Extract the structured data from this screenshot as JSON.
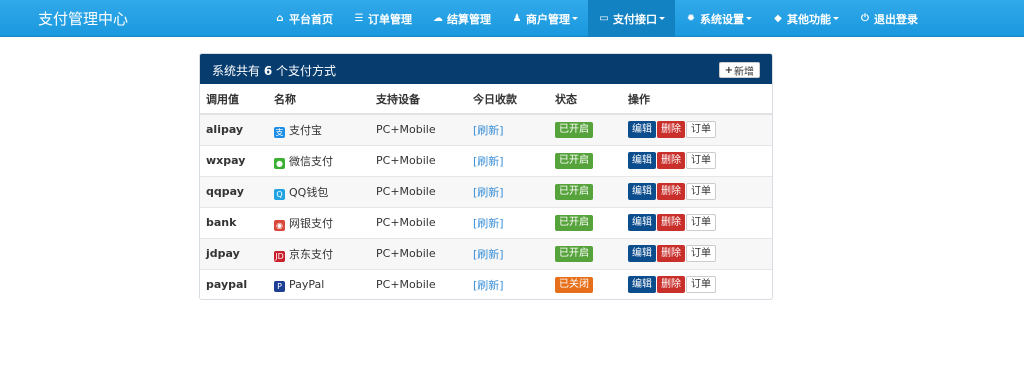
{
  "app": {
    "title": "支付管理中心"
  },
  "nav": [
    {
      "label": "平台首页",
      "icon": "home-icon",
      "glyph": "⌂",
      "active": false,
      "dropdown": false
    },
    {
      "label": "订单管理",
      "icon": "list-icon",
      "glyph": "☰",
      "active": false,
      "dropdown": false
    },
    {
      "label": "结算管理",
      "icon": "cloud-icon",
      "glyph": "☁",
      "active": false,
      "dropdown": false
    },
    {
      "label": "商户管理",
      "icon": "user-icon",
      "glyph": "♟",
      "active": false,
      "dropdown": true
    },
    {
      "label": "支付接口",
      "icon": "credit-card-icon",
      "glyph": "▭",
      "active": true,
      "dropdown": true
    },
    {
      "label": "系统设置",
      "icon": "gear-icon",
      "glyph": "✹",
      "active": false,
      "dropdown": true
    },
    {
      "label": "其他功能",
      "icon": "cube-icon",
      "glyph": "◆",
      "active": false,
      "dropdown": true
    },
    {
      "label": "退出登录",
      "icon": "power-icon",
      "glyph": "⏻",
      "active": false,
      "dropdown": false
    }
  ],
  "panel": {
    "title_prefix": "系统共有",
    "count": "6",
    "title_suffix": "个支付方式",
    "add_label": "新增"
  },
  "table": {
    "headers": [
      "调用值",
      "名称",
      "支持设备",
      "今日收款",
      "状态",
      "操作"
    ],
    "rows": [
      {
        "code": "alipay",
        "name": "支付宝",
        "icon": "alipay-icon",
        "icon_color": "#1d8ee5",
        "icon_glyph": "支",
        "device": "PC+Mobile",
        "income": "[刷新]",
        "status": "已开启",
        "enabled": true
      },
      {
        "code": "wxpay",
        "name": "微信支付",
        "icon": "wechat-icon",
        "icon_color": "#3cb034",
        "icon_glyph": "●",
        "device": "PC+Mobile",
        "income": "[刷新]",
        "status": "已开启",
        "enabled": true
      },
      {
        "code": "qqpay",
        "name": "QQ钱包",
        "icon": "qq-icon",
        "icon_color": "#1fa3e3",
        "icon_glyph": "Q",
        "device": "PC+Mobile",
        "income": "[刷新]",
        "status": "已开启",
        "enabled": true
      },
      {
        "code": "bank",
        "name": "网银支付",
        "icon": "bank-icon",
        "icon_color": "#d9473a",
        "icon_glyph": "◉",
        "device": "PC+Mobile",
        "income": "[刷新]",
        "status": "已开启",
        "enabled": true
      },
      {
        "code": "jdpay",
        "name": "京东支付",
        "icon": "jd-icon",
        "icon_color": "#c81f2a",
        "icon_glyph": "JD",
        "device": "PC+Mobile",
        "income": "[刷新]",
        "status": "已开启",
        "enabled": true
      },
      {
        "code": "paypal",
        "name": "PayPal",
        "icon": "paypal-icon",
        "icon_color": "#1c3f94",
        "icon_glyph": "P",
        "device": "PC+Mobile",
        "income": "[刷新]",
        "status": "已关闭",
        "enabled": false
      }
    ],
    "actions": {
      "edit": "编辑",
      "delete": "删除",
      "orders": "订单"
    }
  },
  "colors": {
    "navbar": "#1a98de",
    "nav_active": "#1382c2",
    "panel_header": "#073c6f",
    "status_on": "#56a33c",
    "status_off": "#e76f1a",
    "edit_button": "#0c4d8e",
    "delete_button": "#c9302c",
    "link": "#3a8fd8"
  }
}
